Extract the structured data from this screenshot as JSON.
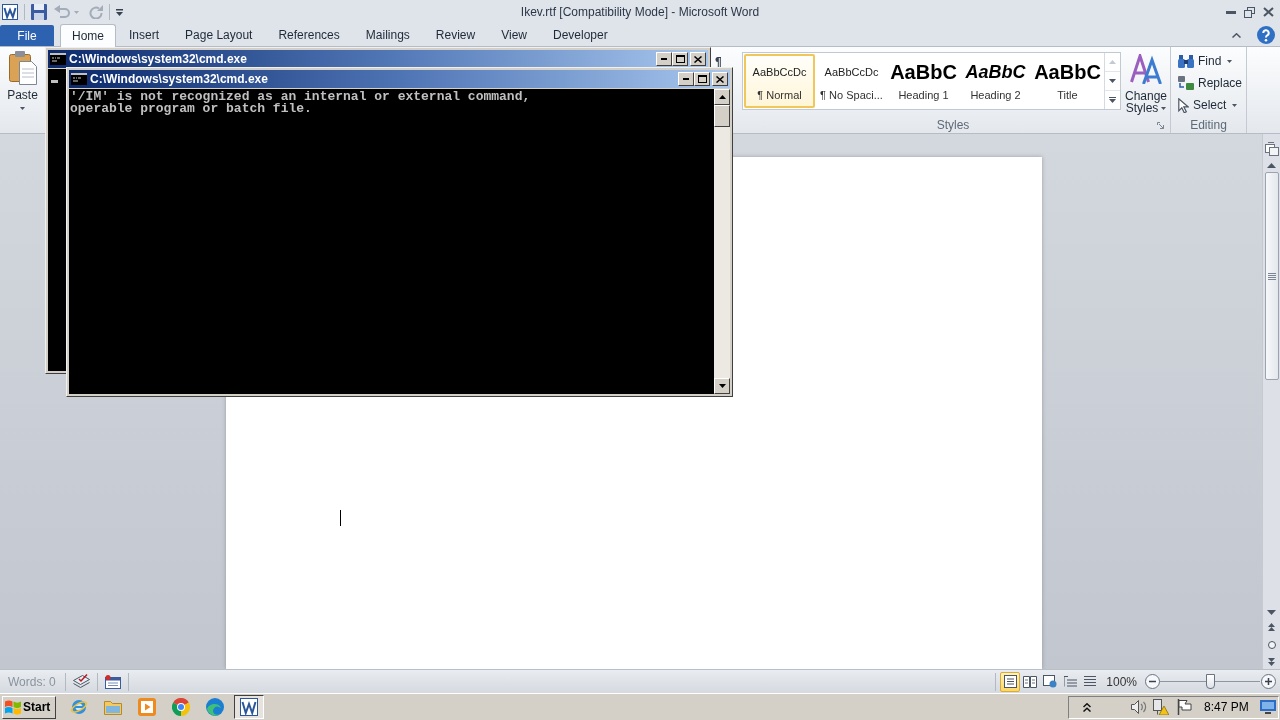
{
  "window": {
    "title": "Ikev.rtf [Compatibility Mode] - Microsoft Word"
  },
  "ribbon_tabs": [
    {
      "label": "File",
      "kind": "backstage",
      "selected": false
    },
    {
      "label": "Home",
      "kind": "tab",
      "selected": true
    },
    {
      "label": "Insert",
      "kind": "tab",
      "selected": false
    },
    {
      "label": "Page Layout",
      "kind": "tab",
      "selected": false
    },
    {
      "label": "References",
      "kind": "tab",
      "selected": false
    },
    {
      "label": "Mailings",
      "kind": "tab",
      "selected": false
    },
    {
      "label": "Review",
      "kind": "tab",
      "selected": false
    },
    {
      "label": "View",
      "kind": "tab",
      "selected": false
    },
    {
      "label": "Developer",
      "kind": "tab",
      "selected": false
    }
  ],
  "clipboard": {
    "paste_label": "Paste"
  },
  "styles": {
    "items": [
      {
        "preview": "AaBbCcDc",
        "label": "¶ Normal",
        "kind": "body",
        "selected": true
      },
      {
        "preview": "AaBbCcDc",
        "label": "¶ No Spaci...",
        "kind": "body",
        "selected": false
      },
      {
        "preview": "AaBbC",
        "label": "Heading 1",
        "kind": "heading",
        "selected": false
      },
      {
        "preview": "AaBbC",
        "label": "Heading 2",
        "kind": "subheading",
        "selected": false
      },
      {
        "preview": "AaBbC",
        "label": "Title",
        "kind": "title",
        "selected": false
      }
    ],
    "change_styles_label": "Change Styles",
    "group_label": "Styles"
  },
  "editing": {
    "items": [
      {
        "label": "Find",
        "kind": "find",
        "dropdown": true
      },
      {
        "label": "Replace",
        "kind": "replace",
        "dropdown": false
      },
      {
        "label": "Select",
        "kind": "select",
        "dropdown": true
      }
    ],
    "group_label": "Editing"
  },
  "status_bar": {
    "words": "Words: 0",
    "views": [
      {
        "kind": "print",
        "selected": true
      },
      {
        "kind": "reading",
        "selected": false
      },
      {
        "kind": "web",
        "selected": false
      },
      {
        "kind": "outline",
        "selected": false
      },
      {
        "kind": "draft",
        "selected": false
      }
    ],
    "zoom": "100%",
    "zoom_slider": {
      "level": 0.5
    }
  },
  "taskbar": {
    "start_label": "Start",
    "apps": [
      {
        "kind": "ie",
        "selected": false
      },
      {
        "kind": "folder",
        "selected": false
      },
      {
        "kind": "player",
        "selected": false
      },
      {
        "kind": "chrome",
        "selected": false
      },
      {
        "kind": "edge",
        "selected": false
      },
      {
        "kind": "word",
        "selected": true
      }
    ],
    "clock": "8:47 PM"
  },
  "consoles": [
    {
      "title": "C:\\Windows\\system32\\cmd.exe"
    },
    {
      "title": "C:\\Windows\\system32\\cmd.exe",
      "lines": [
        "'/IM' is not recognized as an internal or external command,",
        "operable program or batch file."
      ]
    }
  ]
}
